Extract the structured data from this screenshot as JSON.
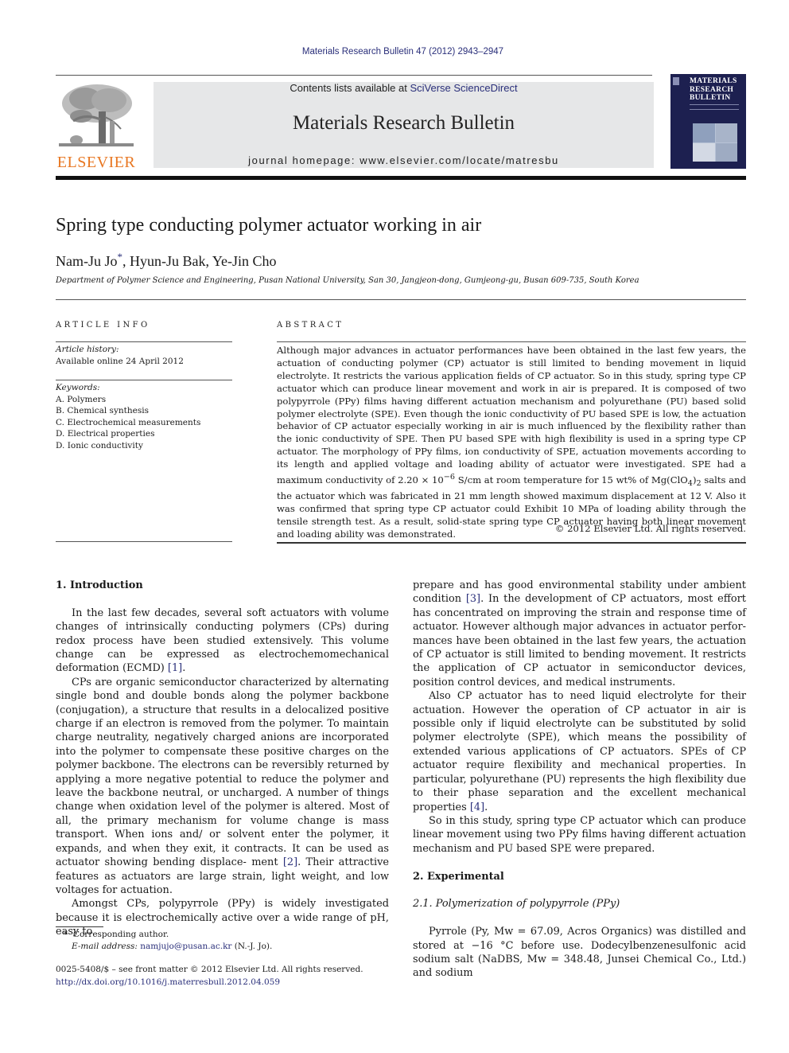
{
  "header": {
    "citation": "Materials Research Bulletin 47 (2012) 2943–2947",
    "contents_prefix": "Contents lists available at ",
    "contents_link": "SciVerse ScienceDirect",
    "journal_name": "Materials Research Bulletin",
    "homepage": "journal homepage: www.elsevier.com/locate/matresbu",
    "publisher_logo_text": "ELSEVIER",
    "cover_title_lines": [
      "MATERIALS",
      "RESEARCH",
      "BULLETIN"
    ]
  },
  "article": {
    "title": "Spring type conducting polymer actuator working in air",
    "authors": [
      {
        "name": "Nam-Ju Jo",
        "mark": "*"
      },
      {
        "name": "Hyun-Ju Bak",
        "mark": ""
      },
      {
        "name": "Ye-Jin Cho",
        "mark": ""
      }
    ],
    "affiliation": "Department of Polymer Science and Engineering, Pusan National University, San 30, Jangjeon-dong, Gumjeong-gu, Busan 609-735, South Korea"
  },
  "article_info": {
    "heading": "ARTICLE INFO",
    "history_label": "Article history:",
    "history_value": "Available online 24 April 2012",
    "keywords_label": "Keywords:",
    "keywords": [
      "A. Polymers",
      "B. Chemical synthesis",
      "C. Electrochemical measurements",
      "D. Electrical properties",
      "D. Ionic conductivity"
    ]
  },
  "abstract": {
    "heading": "ABSTRACT",
    "text_part1": "Although major advances in actuator performances have been obtained in the last few years, the actuation of conducting polymer (CP) actuator is still limited to bending movement in liquid electrolyte. It restricts the various application fields of CP actuator. So in this study, spring type CP actuator which can produce linear movement and work in air is prepared. It is composed of two polypyrrole (PPy) films having different actuation mechanism and polyurethane (PU) based solid polymer electrolyte (SPE). Even though the ionic conductivity of PU based SPE is low, the actuation behavior of CP actuator especially working in air is much influenced by the flexibility rather than the ionic conductivity of SPE. Then PU based SPE with high flexibility is used in a spring type CP actuator. The morphology of PPy films, ion conductivity of SPE, actuation movements according to its length and applied voltage and loading ability of actuator were investigated. SPE had a maximum conductivity of 2.20 × 10",
    "exponent": "−6",
    "text_part2": " S/cm at room temperature for 15 wt% of Mg(ClO",
    "subscript1": "4",
    "text_part3": ")",
    "subscript2": "2",
    "text_part4": " salts and the actuator which was fabricated in 21 mm length showed maximum displacement at 12 V. Also it was confirmed that spring type CP actuator could Exhibit 10 MPa of loading ability through the tensile strength test. As a result, solid-state spring type CP actuator having both linear movement and loading ability was demonstrated.",
    "copyright": "© 2012 Elsevier Ltd. All rights reserved."
  },
  "body": {
    "intro_heading": "1.  Introduction",
    "p1_text": "In the last few decades, several soft actuators with volume changes of intrinsically conducting polymers (CPs) during redox process have been studied extensively. This volume change can be expressed as electrochemomechanical deformation (ECMD) ",
    "p1_ref": "[1]",
    "p1_end": ".",
    "p2_text": "CPs are organic semiconductor characterized by alternating single bond and double bonds along the polymer backbone (conjugation), a structure that results in a delocalized positive charge if an electron is removed from the polymer. To maintain charge neutrality, negatively charged anions are incorporated into the polymer to compensate these positive charges on the polymer backbone. The electrons can be reversibly returned by applying a more negative potential to reduce the polymer and leave the backbone neutral, or uncharged. A number of things change when oxidation level of the polymer is altered. Most of all, the primary mechanism for volume change is mass transport. When ions and/ or solvent enter the polymer, it expands, and when they exit, it contracts. It can be used as actuator showing bending displace- ment ",
    "p2_ref": "[2]",
    "p2_end": ". Their attractive features as actuators are large strain, light weight, and low voltages for actuation.",
    "p3_text": "Amongst CPs, polypyrrole (PPy) is widely investigated because it is electrochemically active over a wide range of pH, easy to",
    "p3_cont": "prepare and has good environmental stability under ambient condition ",
    "p3_ref": "[3]",
    "p3_end": ". In the development of CP actuators, most effort has concentrated on improving the strain and response time of actuator. However although major advances in actuator perfor- mances have been obtained in the last few years, the actuation of CP actuator is still limited to bending movement. It restricts the application of CP actuator in semiconductor devices, position control devices, and medical instruments.",
    "p4_text": "Also CP actuator has to need liquid electrolyte for their actuation. However the operation of CP actuator in air is possible only if liquid electrolyte can be substituted by solid polymer electrolyte (SPE), which means the possibility of extended various applications of CP actuators. SPEs of CP actuator require flexibility and mechanical properties. In particular, polyurethane (PU) represents the high flexibility due to their phase separation and the excellent mechanical properties ",
    "p4_ref": "[4]",
    "p4_end": ".",
    "p5_text": "So in this study, spring type CP actuator which can produce linear movement using two PPy films having different actuation mechanism and PU based SPE were prepared.",
    "exp_heading": "2.  Experimental",
    "sub_heading": "2.1.  Polymerization of polypyrrole (PPy)",
    "p6_text": "Pyrrole (Py, Mw = 67.09, Acros Organics) was distilled and stored at −16 °C before use. Dodecylbenzenesulfonic acid sodium salt (NaDBS, Mw = 348.48, Junsei Chemical Co., Ltd.) and sodium"
  },
  "footnote": {
    "mark": "*",
    "corresponding": "Corresponding author.",
    "email_label": "E-mail address: ",
    "email": "namjujo@pusan.ac.kr",
    "email_suffix": " (N.-J. Jo)."
  },
  "front_matter": {
    "issn_line": "0025-5408/$ – see front matter © 2012 Elsevier Ltd. All rights reserved.",
    "doi": "http://dx.doi.org/10.1016/j.materresbull.2012.04.059"
  },
  "colors": {
    "link": "#2a2f7a",
    "elsevier_orange": "#e87722",
    "banner_bg": "#e6e7e8",
    "cover_bg": "#1d2050"
  }
}
